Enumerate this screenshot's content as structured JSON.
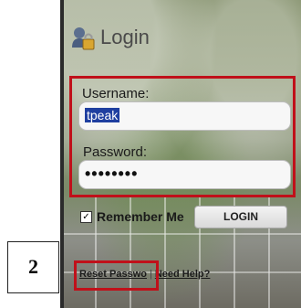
{
  "header": {
    "title": "Login",
    "icon": "user-lock-icon"
  },
  "form": {
    "username_label": "Username:",
    "username_value": "tpeak",
    "password_label": "Password:",
    "password_value": "••••••••",
    "remember_label": "Remember Me",
    "remember_checked": true,
    "login_button": "LOGIN"
  },
  "links": {
    "reset_password": "Reset Passwo",
    "separator": "|",
    "need_help": "Need Help?"
  },
  "annotation": {
    "step_number": "2",
    "highlight_color": "#c0101a"
  }
}
